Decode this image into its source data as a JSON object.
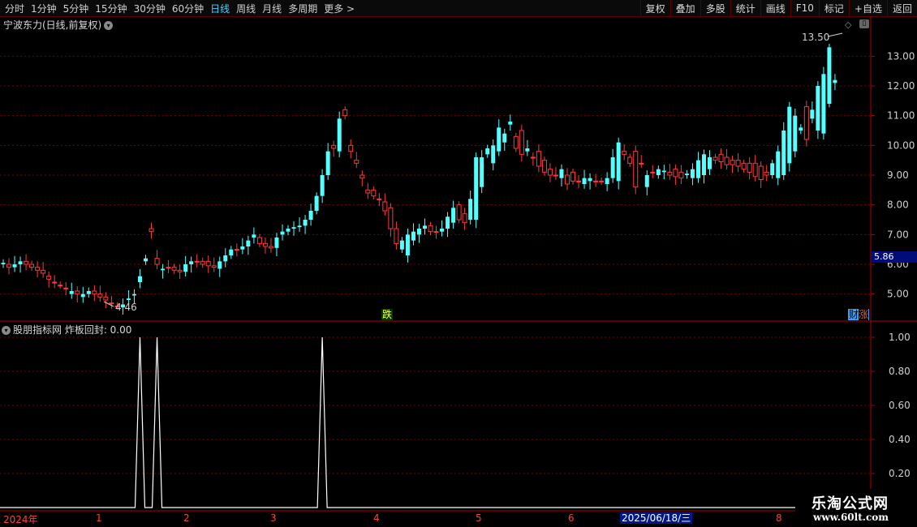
{
  "toolbar": {
    "periods": [
      "分时",
      "1分钟",
      "5分钟",
      "15分钟",
      "30分钟",
      "60分钟",
      "日线",
      "周线",
      "月线",
      "多周期",
      "更多 >"
    ],
    "active_period": "日线",
    "actions": [
      "复权",
      "叠加",
      "多股",
      "统计",
      "画线",
      "F10",
      "标记",
      "+自选",
      "返回"
    ]
  },
  "stock": {
    "title": "宁波东力(日线,前复权)"
  },
  "price_axis": {
    "ticks": [
      "13.00",
      "12.00",
      "11.00",
      "10.00",
      "9.00",
      "8.00",
      "7.00",
      "6.00",
      "5.00"
    ],
    "current": "5.86"
  },
  "annotations": {
    "high": "13.50",
    "low": "4.46",
    "die_badge": "跌",
    "cai_badge": "财",
    "zhang_badge": "涨"
  },
  "indicator": {
    "title": "股朋指标网 炸板回封: 0.00",
    "ticks": [
      "1.00",
      "0.80",
      "0.60",
      "0.40",
      "0.20"
    ]
  },
  "date_axis": {
    "labels": [
      "2024年",
      "1",
      "2",
      "3",
      "4",
      "5",
      "6",
      "7",
      "8"
    ],
    "highlighted": "2025/06/18/三"
  },
  "watermark": {
    "title": "乐淘公式网",
    "url": "www.60lt.com"
  },
  "colors": {
    "up": "#ff3a3a",
    "down": "#54ffff",
    "grid": "#7a0000",
    "axis": "#b00000"
  },
  "chart_data": [
    {
      "type": "candlestick",
      "title": "宁波东力(日线,前复权)",
      "y_range": [
        4.2,
        13.8
      ],
      "x_range": [
        "2024-12",
        "2025-08"
      ],
      "close": [
        6.0,
        6.0,
        5.9,
        6.0,
        6.1,
        6.0,
        5.9,
        5.8,
        5.6,
        5.4,
        5.3,
        5.2,
        5.0,
        5.1,
        4.9,
        5.0,
        5.1,
        5.0,
        4.9,
        4.7,
        4.6,
        4.55,
        4.8,
        4.95,
        5.4,
        6.1,
        7.2,
        6.2,
        5.8,
        5.9,
        5.9,
        5.8,
        5.75,
        6.0,
        6.1,
        6.1,
        6.1,
        5.95,
        5.85,
        6.1,
        6.3,
        6.5,
        6.5,
        6.6,
        6.9,
        6.9,
        6.7,
        6.6,
        6.55,
        7.0,
        7.1,
        7.2,
        7.25,
        7.3,
        7.5,
        7.8,
        8.3,
        9.0,
        10.0,
        9.8,
        11.2,
        10.0,
        9.5,
        9.0,
        8.5,
        8.5,
        8.2,
        8.1,
        7.9,
        7.2,
        6.5,
        6.3,
        6.8,
        7.0,
        7.2,
        7.3,
        7.1,
        7.1,
        7.2,
        7.4,
        8.0,
        7.7,
        7.5,
        7.5,
        8.6,
        9.7,
        9.4,
        9.8,
        10.1,
        10.7,
        10.3,
        10.5,
        9.8,
        9.6,
        9.8,
        9.5,
        9.2,
        9.0,
        8.9,
        9.0,
        9.1,
        8.8,
        8.7,
        8.8,
        8.8,
        8.8,
        8.7,
        8.9,
        8.8,
        9.8,
        9.6,
        9.8,
        9.4,
        8.6,
        9.1,
        9.0,
        9.1,
        9.1,
        9.2,
        9.1,
        9.0,
        8.9,
        8.9,
        9.0,
        9.2,
        9.6,
        9.7,
        9.6,
        9.5,
        9.5,
        9.4,
        9.4,
        9.4,
        9.3,
        9.1,
        9.0,
        8.9,
        9.0,
        9.4,
        9.8,
        10.5,
        11.3,
        10.9,
        10.5,
        10.4,
        11.4,
        12.1,
        13.1,
        12.4,
        12.6
      ],
      "open": [
        6.05,
        5.9,
        6.0,
        6.1,
        6.0,
        5.9,
        5.8,
        5.7,
        5.5,
        5.4,
        5.3,
        5.2,
        5.1,
        5.0,
        5.0,
        5.1,
        5.0,
        4.9,
        4.8,
        4.7,
        4.6,
        4.65,
        4.85,
        5.0,
        5.6,
        6.2,
        7.1,
        6.0,
        5.85,
        5.9,
        5.8,
        5.75,
        6.0,
        6.1,
        6.1,
        6.0,
        5.95,
        5.9,
        6.1,
        6.3,
        6.5,
        6.5,
        6.6,
        6.8,
        7.0,
        6.7,
        6.6,
        6.55,
        6.9,
        7.1,
        7.2,
        7.25,
        7.3,
        7.5,
        7.8,
        8.3,
        9.0,
        9.8,
        9.9,
        10.9,
        11.0,
        9.8,
        9.4,
        8.9,
        8.4,
        8.3,
        8.2,
        7.8,
        7.2,
        6.7,
        6.8,
        7.0,
        7.1,
        7.2,
        7.3,
        7.1,
        7.1,
        7.2,
        7.6,
        7.9,
        7.5,
        7.4,
        8.2,
        9.6,
        9.6,
        9.9,
        10.0,
        10.6,
        10.4,
        10.8,
        9.9,
        9.7,
        9.9,
        9.6,
        9.3,
        9.1,
        9.0,
        9.0,
        9.2,
        8.7,
        8.8,
        8.8,
        8.9,
        8.9,
        8.8,
        8.8,
        8.9,
        9.6,
        10.1,
        9.7,
        9.4,
        8.6,
        9.4,
        9.0,
        9.1,
        9.2,
        9.15,
        9.0,
        8.95,
        8.9,
        9.05,
        9.2,
        9.5,
        9.7,
        9.6,
        9.5,
        9.45,
        9.35,
        9.35,
        9.3,
        9.2,
        9.1,
        8.95,
        8.85,
        9.0,
        9.4,
        9.8,
        10.5,
        11.3,
        11.0,
        10.6,
        10.2,
        11.2,
        12.0,
        12.4,
        13.3,
        12.2
      ]
    },
    {
      "type": "line",
      "title": "股朋指标网 炸板回封: 0.00",
      "y_range": [
        0,
        1.05
      ],
      "series": [
        {
          "name": "炸板回封",
          "values": [
            0,
            0,
            0,
            0,
            0,
            0,
            0,
            0,
            0,
            0,
            0,
            0,
            0,
            0,
            0,
            0,
            0,
            0,
            0,
            0,
            0,
            0,
            0,
            0,
            0,
            0,
            0,
            0,
            0,
            0,
            0,
            0,
            0,
            0,
            0,
            0,
            0,
            0,
            0,
            0,
            0,
            0,
            0,
            0,
            0,
            0,
            0,
            0,
            0,
            0,
            0,
            0,
            0,
            0,
            0,
            0,
            0,
            0,
            0,
            0,
            0,
            0,
            0,
            0,
            0,
            0,
            0,
            0,
            0,
            0,
            0,
            0,
            0,
            0,
            0,
            0,
            0,
            0,
            0,
            0,
            0,
            0,
            0,
            0,
            0,
            0,
            0,
            0,
            0,
            0,
            0,
            0,
            0,
            0,
            0,
            0,
            0,
            0,
            0,
            0,
            0,
            0,
            0,
            0,
            0,
            0,
            0,
            0,
            0,
            0,
            0,
            0,
            0,
            0,
            0,
            0,
            0,
            0,
            0,
            0,
            0,
            0,
            0,
            0,
            0,
            0,
            0,
            0,
            0,
            0,
            0,
            0,
            0,
            0,
            0,
            0,
            0,
            0,
            0,
            0,
            0,
            0,
            0,
            0,
            0,
            0,
            0,
            0,
            0,
            0,
            0
          ]
        }
      ],
      "spikes_at_index": [
        24,
        27,
        56
      ]
    }
  ]
}
